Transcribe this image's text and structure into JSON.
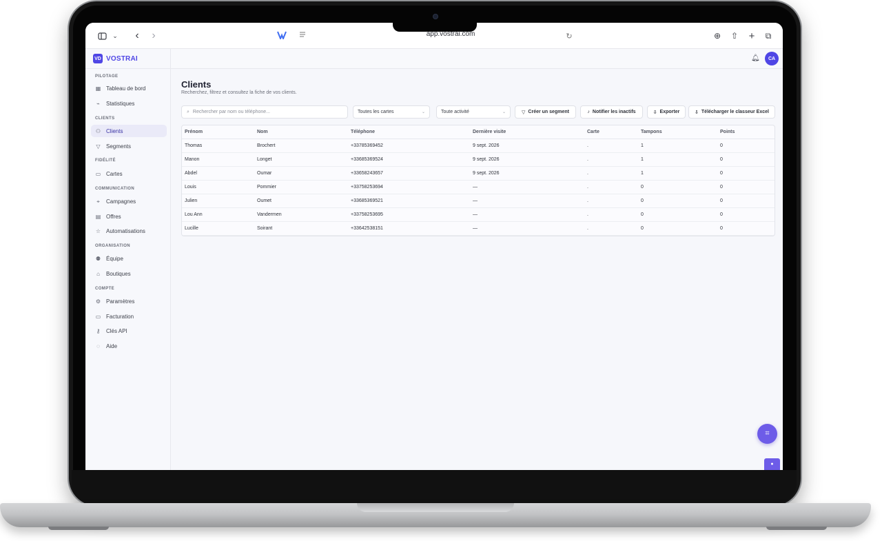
{
  "browser": {
    "url": "app.vostrai.com",
    "sidebar_toggle_icon": "sidebar-icon",
    "icons": [
      "sidebar-icon",
      "chevron-down-icon",
      "back-icon",
      "forward-icon",
      "reload-icon",
      "download-icon",
      "share-icon",
      "new-tab-icon",
      "tabs-icon"
    ]
  },
  "brand": {
    "logo_text": "VD",
    "name": "VOSTRAI",
    "color": "#4f46e5"
  },
  "sidebar": {
    "sections": [
      {
        "title": "PILOTAGE",
        "items": [
          {
            "label": "Tableau de bord",
            "icon": "dashboard-icon"
          },
          {
            "label": "Statistiques",
            "icon": "chart-icon"
          }
        ]
      },
      {
        "title": "CLIENTS",
        "items": [
          {
            "label": "Clients",
            "icon": "users-icon",
            "active": true
          },
          {
            "label": "Segments",
            "icon": "filter-icon"
          }
        ]
      },
      {
        "title": "FIDÉLITÉ",
        "items": [
          {
            "label": "Cartes",
            "icon": "card-icon"
          }
        ]
      },
      {
        "title": "COMMUNICATION",
        "items": [
          {
            "label": "Campagnes",
            "icon": "megaphone-icon"
          },
          {
            "label": "Offres",
            "icon": "tag-icon"
          },
          {
            "label": "Automatisations",
            "icon": "star-icon"
          }
        ]
      },
      {
        "title": "ORGANISATION",
        "items": [
          {
            "label": "Équipe",
            "icon": "team-icon"
          },
          {
            "label": "Boutiques",
            "icon": "store-icon"
          }
        ]
      },
      {
        "title": "COMPTE",
        "items": [
          {
            "label": "Paramètres",
            "icon": "gear-icon"
          },
          {
            "label": "Facturation",
            "icon": "billing-icon"
          },
          {
            "label": "Clés API",
            "icon": "key-icon"
          },
          {
            "label": "Aide",
            "icon": "help-icon"
          }
        ]
      }
    ]
  },
  "header": {
    "bell_icon": "bell-icon",
    "avatar_initials": "CA"
  },
  "page": {
    "title": "Clients",
    "subtitle": "Recherchez, filtrez et consultez la fiche de vos clients."
  },
  "filters": {
    "search_placeholder": "Rechercher par nom ou téléphone...",
    "card_filter": "Toutes les cartes",
    "activity_filter": "Toute activité",
    "create_segment": "Créer un segment",
    "notify_inactive": "Notifier les inactifs",
    "export": "Exporter",
    "download_excel": "Télécharger le classeur Excel"
  },
  "table": {
    "columns": [
      "Prénom",
      "Nom",
      "Téléphone",
      "Dernière visite",
      "Carte",
      "Tampons",
      "Points"
    ],
    "rows": [
      [
        "Thomas",
        "Brochert",
        "+33785369452",
        "9 sept. 2026",
        ".",
        "1",
        "0"
      ],
      [
        "Manon",
        "Longet",
        "+33685369524",
        "9 sept. 2026",
        ".",
        "1",
        "0"
      ],
      [
        "Abdel",
        "Oumar",
        "+33658243657",
        "9 sept. 2026",
        ".",
        "1",
        "0"
      ],
      [
        "Louis",
        "Pommier",
        "+33758253694",
        "—",
        ".",
        "0",
        "0"
      ],
      [
        "Julien",
        "Oumet",
        "+33685369521",
        "—",
        ".",
        "0",
        "0"
      ],
      [
        "Lou Ann",
        "Vandermen",
        "+33758253695",
        "—",
        ".",
        "0",
        "0"
      ],
      [
        "Lucille",
        "Soirant",
        "+33642538151",
        "—",
        ".",
        "0",
        "0"
      ]
    ]
  },
  "actions": {
    "scan_icon": "scan-icon",
    "mini_tab_icon": "assistant-icon",
    "accent": "#6d5ce8"
  }
}
